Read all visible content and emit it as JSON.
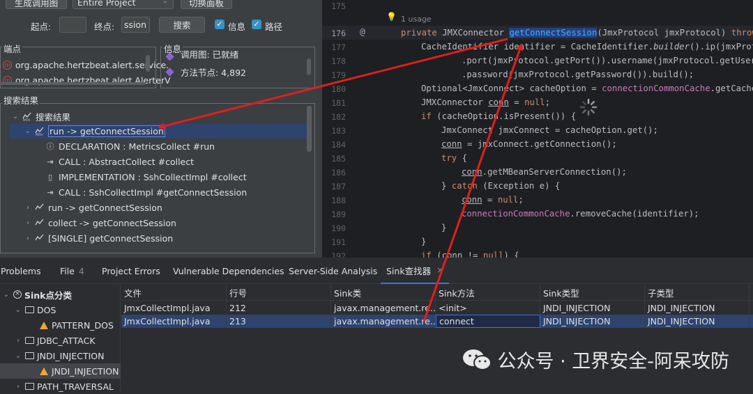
{
  "toolbar": {
    "gen_callgraph_btn": "生成调用图",
    "scope_select": "Entire Project",
    "switch_panel_btn": "切换面板",
    "start_label": "起点:",
    "start_value": "",
    "end_label": "终点:",
    "end_value": "ssion",
    "search_btn": "搜索",
    "info_checkbox": "信息",
    "path_checkbox": "路径"
  },
  "endpoints": {
    "title": "端点",
    "items": [
      "org.apache.hertzbeat.alert.service.",
      "org.apache.hertzbeat.alert.AlerterV"
    ]
  },
  "info": {
    "title": "信息",
    "line1": "调用图: 已就绪",
    "line2": "方法节点: 4,892"
  },
  "results": {
    "title": "搜索结果",
    "root": "搜索结果",
    "expanded_path": "run -> getConnectSession",
    "children": [
      {
        "icon": "info",
        "text": "DECLARATION : MetricsCollect #run"
      },
      {
        "icon": "call",
        "text": "CALL : AbstractCollect #collect"
      },
      {
        "icon": "impl",
        "text": "IMPLEMENTATION : SshCollectImpl #collect"
      },
      {
        "icon": "call",
        "text": "CALL : SshCollectImpl #getConnectSession"
      }
    ],
    "others": [
      "run -> getConnectSession",
      "collect -> getConnectSession",
      "[SINGLE] getConnectSession"
    ]
  },
  "editor": {
    "usage_hint": "1 usage",
    "lines": [
      "175",
      "176",
      "177",
      "178",
      "179",
      "180",
      "181",
      "182",
      "183",
      "184",
      "185",
      "186",
      "187",
      "188",
      "189",
      "190",
      "191",
      "192"
    ]
  },
  "bottom_tabs": [
    {
      "label": "Problems"
    },
    {
      "label": "File",
      "count": "4"
    },
    {
      "label": "Project Errors"
    },
    {
      "label": "Vulnerable Dependencies"
    },
    {
      "label": "Server-Side Analysis"
    },
    {
      "label": "Sink查找器",
      "active": true
    }
  ],
  "sink_tree": {
    "root": "Sink点分类",
    "nodes": [
      {
        "label": "DOS",
        "type": "folder",
        "expanded": true
      },
      {
        "label": "PATTERN_DOS",
        "type": "warning"
      },
      {
        "label": "JDBC_ATTACK",
        "type": "folder",
        "expanded": false
      },
      {
        "label": "JNDI_INJECTION",
        "type": "folder",
        "expanded": true
      },
      {
        "label": "JNDI_INJECTION",
        "type": "warning",
        "selected": true
      },
      {
        "label": "PATH_TRAVERSAL",
        "type": "folder",
        "expanded": false
      }
    ]
  },
  "sink_table": {
    "headers": [
      "文件",
      "行号",
      "Sink类",
      "Sink方法",
      "Sink类型",
      "子类型"
    ],
    "rows": [
      [
        "JmxCollectImpl.java",
        "212",
        "javax.management.re...",
        "<init>",
        "JNDI_INJECTION",
        "JNDI_INJECTION"
      ],
      [
        "JmxCollectImpl.java",
        "213",
        "javax.management.re...",
        "connect",
        "JNDI_INJECTION",
        "JNDI_INJECTION"
      ]
    ],
    "selected_row": 1
  },
  "watermark": "公众号 · 卫界安全-阿呆攻防",
  "colors": {
    "accent": "#3592c4",
    "selection": "#2e436e",
    "annotation_arrow": "#e0201b"
  }
}
